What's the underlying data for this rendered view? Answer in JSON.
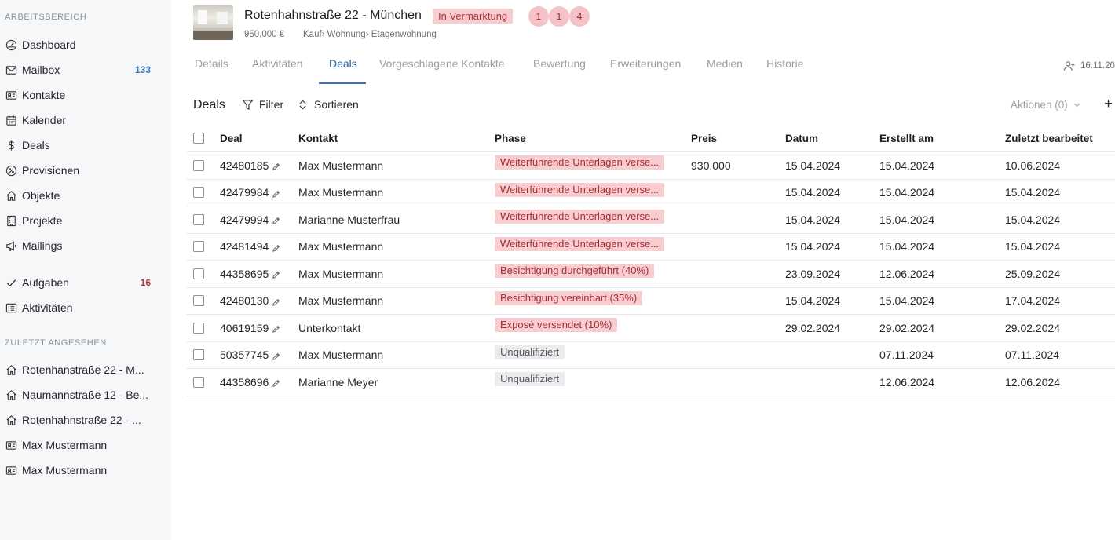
{
  "sidebar": {
    "section1": "ARBEITSBEREICH",
    "items": [
      {
        "label": "Dashboard",
        "icon": "dashboard-icon",
        "count": ""
      },
      {
        "label": "Mailbox",
        "icon": "mail-icon",
        "count": "133"
      },
      {
        "label": "Kontakte",
        "icon": "contact-card-icon",
        "count": ""
      },
      {
        "label": "Kalender",
        "icon": "calendar-icon",
        "count": ""
      },
      {
        "label": "Deals",
        "icon": "dollar-icon",
        "count": ""
      },
      {
        "label": "Provisionen",
        "icon": "percent-icon",
        "count": ""
      },
      {
        "label": "Objekte",
        "icon": "home-icon",
        "count": ""
      },
      {
        "label": "Projekte",
        "icon": "building-icon",
        "count": ""
      },
      {
        "label": "Mailings",
        "icon": "megaphone-icon",
        "count": ""
      },
      {
        "label": "Aufgaben",
        "icon": "check-icon",
        "count": "16"
      },
      {
        "label": "Aktivitäten",
        "icon": "list-icon",
        "count": ""
      }
    ],
    "section2": "ZULETZT ANGESEHEN",
    "recent": [
      {
        "label": "Rotenhanstraße 22 - M...",
        "icon": "home-icon"
      },
      {
        "label": "Naumannstraße 12 - Be...",
        "icon": "home-icon"
      },
      {
        "label": "Rotenhahnstraße 22 - ...",
        "icon": "home-icon"
      },
      {
        "label": "Max Mustermann",
        "icon": "contact-card-icon"
      },
      {
        "label": "Max Mustermann",
        "icon": "contact-card-icon"
      }
    ]
  },
  "header": {
    "title": "Rotenhahnstraße 22 - München",
    "status": "In Vermarktung",
    "badges": [
      "1",
      "1",
      "4"
    ],
    "price": "950.000 €",
    "category": "Kauf› Wohnung› Etagenwohnung"
  },
  "tabs": [
    "Details",
    "Aktivitäten",
    "Deals",
    "Vorgeschlagene Kontakte",
    "Bewertung",
    "Erweiterungen",
    "Medien",
    "Historie"
  ],
  "active_tab": "Deals",
  "right_info": "16.11.20",
  "toolbar": {
    "title": "Deals",
    "filter": "Filter",
    "sort": "Sortieren",
    "actions": "Aktionen (0)",
    "add": "+"
  },
  "table": {
    "columns": [
      "Deal",
      "Kontakt",
      "Phase",
      "Preis",
      "Datum",
      "Erstellt am",
      "Zuletzt bearbeitet"
    ],
    "rows": [
      {
        "deal": "42480185",
        "kontakt": "Max Mustermann",
        "phase": "Weiterführende Unterlagen verse...",
        "phase_color": "red",
        "preis": "930.000",
        "datum": "15.04.2024",
        "erstellt": "15.04.2024",
        "bearbeitet": "10.06.2024"
      },
      {
        "deal": "42479984",
        "kontakt": "Max Mustermann",
        "phase": "Weiterführende Unterlagen verse...",
        "phase_color": "red",
        "preis": "",
        "datum": "15.04.2024",
        "erstellt": "15.04.2024",
        "bearbeitet": "15.04.2024"
      },
      {
        "deal": "42479994",
        "kontakt": "Marianne Musterfrau",
        "phase": "Weiterführende Unterlagen verse...",
        "phase_color": "red",
        "preis": "",
        "datum": "15.04.2024",
        "erstellt": "15.04.2024",
        "bearbeitet": "15.04.2024"
      },
      {
        "deal": "42481494",
        "kontakt": "Max Mustermann",
        "phase": "Weiterführende Unterlagen verse...",
        "phase_color": "red",
        "preis": "",
        "datum": "15.04.2024",
        "erstellt": "15.04.2024",
        "bearbeitet": "15.04.2024"
      },
      {
        "deal": "44358695",
        "kontakt": "Max Mustermann",
        "phase": "Besichtigung durchgeführt (40%)",
        "phase_color": "red",
        "preis": "",
        "datum": "23.09.2024",
        "erstellt": "12.06.2024",
        "bearbeitet": "25.09.2024"
      },
      {
        "deal": "42480130",
        "kontakt": "Max Mustermann",
        "phase": "Besichtigung vereinbart (35%)",
        "phase_color": "red",
        "preis": "",
        "datum": "15.04.2024",
        "erstellt": "15.04.2024",
        "bearbeitet": "17.04.2024"
      },
      {
        "deal": "40619159",
        "kontakt": "Unterkontakt",
        "phase": "Exposé versendet (10%)",
        "phase_color": "red",
        "preis": "",
        "datum": "29.02.2024",
        "erstellt": "29.02.2024",
        "bearbeitet": "29.02.2024"
      },
      {
        "deal": "50357745",
        "kontakt": "Max Mustermann",
        "phase": "Unqualifiziert",
        "phase_color": "gray",
        "preis": "",
        "datum": "",
        "erstellt": "07.11.2024",
        "bearbeitet": "07.11.2024"
      },
      {
        "deal": "44358696",
        "kontakt": "Marianne Meyer",
        "phase": "Unqualifiziert",
        "phase_color": "gray",
        "preis": "",
        "datum": "",
        "erstellt": "12.06.2024",
        "bearbeitet": "12.06.2024"
      }
    ]
  }
}
